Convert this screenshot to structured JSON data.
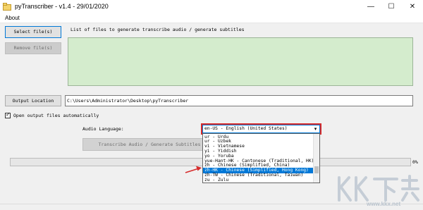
{
  "window": {
    "title": "pyTranscriber - v1.4 - 29/01/2020",
    "minimize_glyph": "—",
    "maximize_glyph": "☐",
    "close_glyph": "✕"
  },
  "menu": {
    "about_label": "About"
  },
  "buttons": {
    "select_files": "Select file(s)",
    "remove_files": "Remove file(s)",
    "output_location": "Output Location",
    "transcribe": "Transcribe Audio / Generate Subtitles"
  },
  "file_list": {
    "label": "List of files to generate transcribe audio / generate subtitles",
    "items": []
  },
  "output_path": "C:\\Users\\Administrator\\Desktop\\pyTranscriber",
  "options": {
    "open_output_label": "Open output files automatically",
    "open_output_checked": true,
    "check_glyph": "✓"
  },
  "language": {
    "label": "Audio Language:",
    "selected_value": "en-US - English (United States)",
    "arrow_glyph": "▾",
    "dropdown_options": [
      "ur - Urdu",
      "ur - Uzbek",
      "vi - Vietnamese",
      "yi - Yiddish",
      "yo - Yoruba",
      "yue-Hant-HK - Cantonese (Traditional, HK)",
      "zh - Chinese (Simplified, China)",
      "zh-HK - Chinese (Simplified, Hong Kong)",
      "zh-TW - Chinese (Traditional, Taiwan)",
      "zu - Zulu"
    ],
    "highlighted_option": "zh-HK - Chinese (Simplified, Hong Kong)"
  },
  "progress": {
    "value": 0,
    "label": "0%"
  },
  "watermark": {
    "text": "KK下载",
    "site": "www.kkx.net"
  },
  "colors": {
    "list_bg": "#d4eccd",
    "accent": "#0078d7",
    "highlight_border": "#d62b2b",
    "annotation_arrow": "#d62b2b",
    "watermark": "#c5cdd6"
  }
}
